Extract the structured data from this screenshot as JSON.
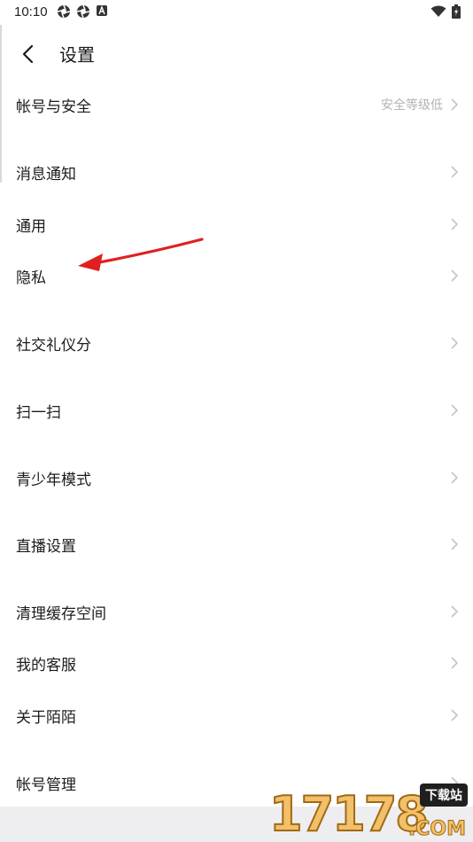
{
  "status": {
    "time": "10:10",
    "left_icons": [
      "aperture-icon",
      "aperture-icon",
      "a-badge-icon"
    ],
    "right_icons": [
      "wifi-icon",
      "battery-charging-icon"
    ]
  },
  "header": {
    "title": "设置",
    "back_icon": "chevron-left-icon"
  },
  "settings": [
    {
      "label": "帐号与安全",
      "sub": "安全等级低"
    },
    {
      "label": "消息通知",
      "sub": ""
    },
    {
      "label": "通用",
      "sub": ""
    },
    {
      "label": "隐私",
      "sub": ""
    },
    {
      "label": "社交礼仪分",
      "sub": ""
    },
    {
      "label": "扫一扫",
      "sub": ""
    },
    {
      "label": "青少年模式",
      "sub": ""
    },
    {
      "label": "直播设置",
      "sub": ""
    },
    {
      "label": "清理缓存空间",
      "sub": ""
    },
    {
      "label": "我的客服",
      "sub": ""
    },
    {
      "label": "关于陌陌",
      "sub": ""
    },
    {
      "label": "帐号管理",
      "sub": ""
    }
  ],
  "annotation": {
    "color": "#e02020"
  },
  "watermark": {
    "digits": "17178",
    "top": "下载站",
    "suffix": ".COM"
  }
}
